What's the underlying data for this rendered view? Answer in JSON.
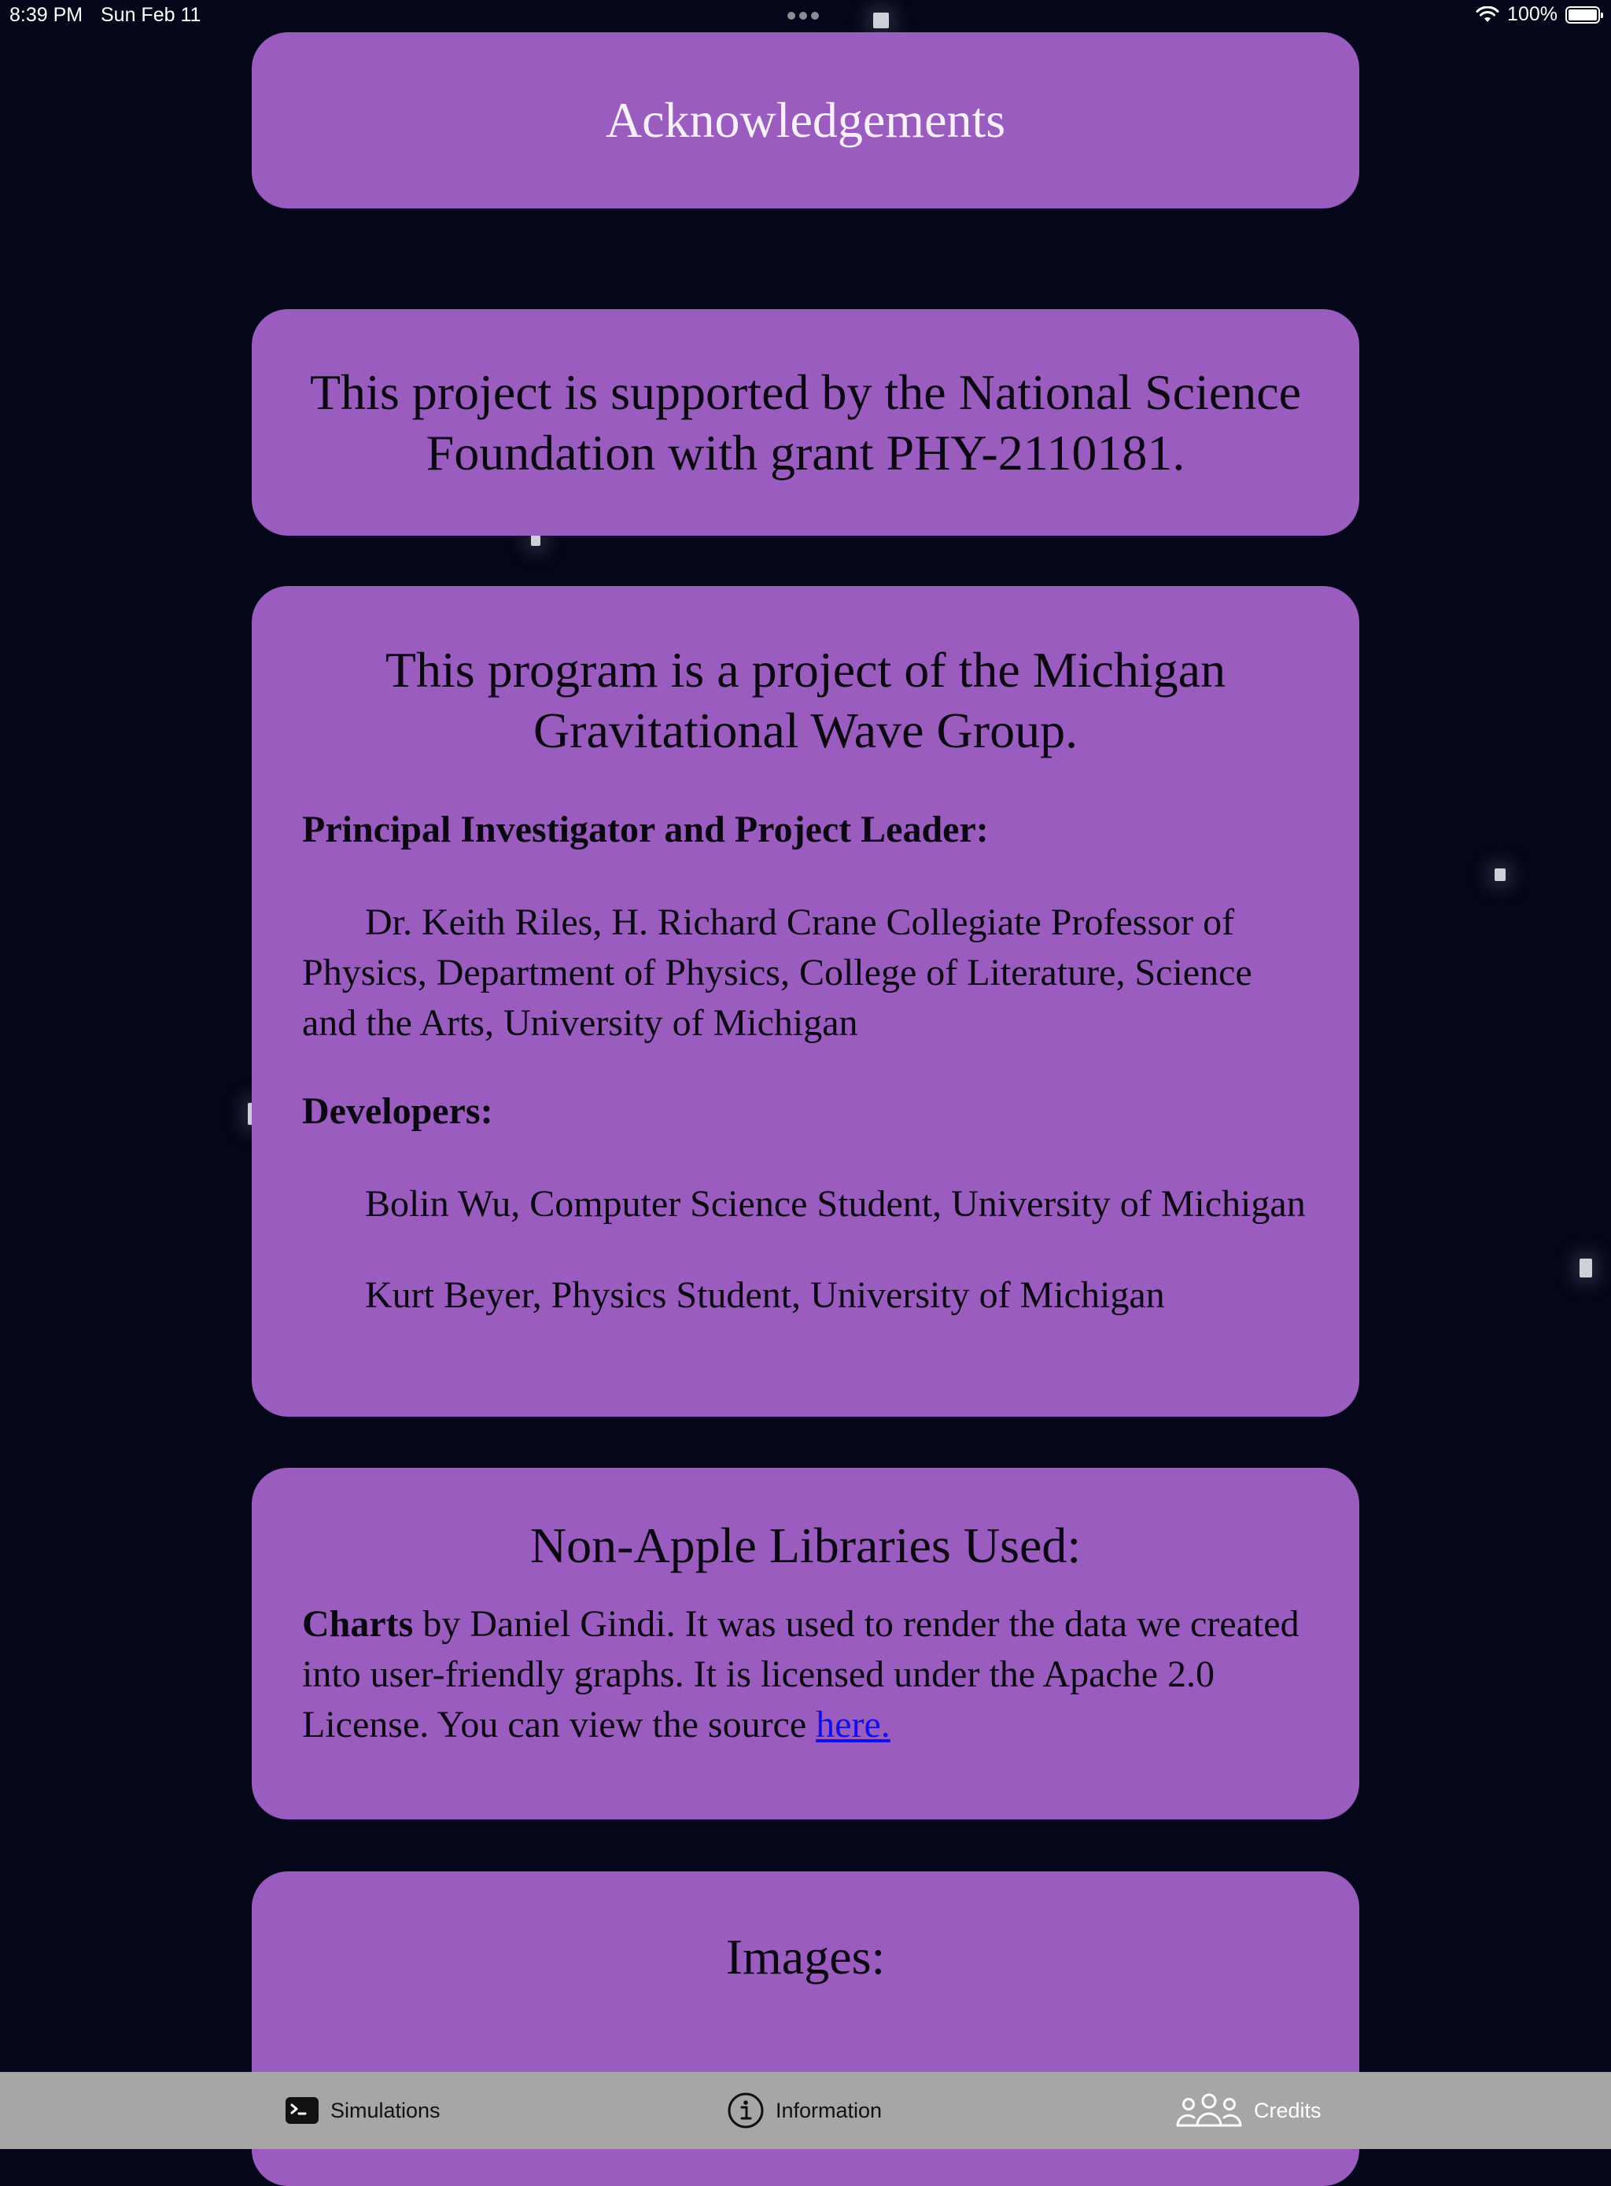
{
  "status_bar": {
    "time": "8:39 PM",
    "date": "Sun Feb 11",
    "battery_label": "100%",
    "battery_level": 1.0,
    "icons": [
      "wifi-icon",
      "battery-icon"
    ]
  },
  "title_card": {
    "title": "Acknowledgements"
  },
  "nsf_card": {
    "text": "This project is supported by the National Science Foundation with grant PHY-2110181."
  },
  "group_card": {
    "heading": "This program is a project of the Michigan Gravitational Wave Group.",
    "pi_label": "Principal Investigator and Project Leader:",
    "pi_text": "Dr. Keith Riles, H. Richard Crane Collegiate Professor of Physics, Department of Physics, College of Literature, Science and the Arts, University of Michigan",
    "developers_label": "Developers:",
    "developer_1": "Bolin Wu, Computer Science Student, University of Michigan",
    "developer_2": "Kurt Beyer, Physics Student, University of Michigan"
  },
  "libs_card": {
    "heading": "Non-Apple Libraries Used:",
    "lib_name": "Charts",
    "lib_text": " by Daniel Gindi. It was used to render the data we created into user-friendly graphs. It is licensed under the Apache 2.0 License. You can view the source ",
    "link_text": "here."
  },
  "images_card": {
    "heading": "Images:"
  },
  "tab_bar": {
    "tabs": [
      {
        "label": "Simulations",
        "icon": "terminal-icon",
        "selected": false
      },
      {
        "label": "Information",
        "icon": "info-icon",
        "selected": false
      },
      {
        "label": "Credits",
        "icon": "people-icon",
        "selected": true
      }
    ]
  },
  "colors": {
    "background": "#06061a",
    "card": "#9a5dbf",
    "link": "#1010ee",
    "tab_bar": "#a6a6a6"
  }
}
